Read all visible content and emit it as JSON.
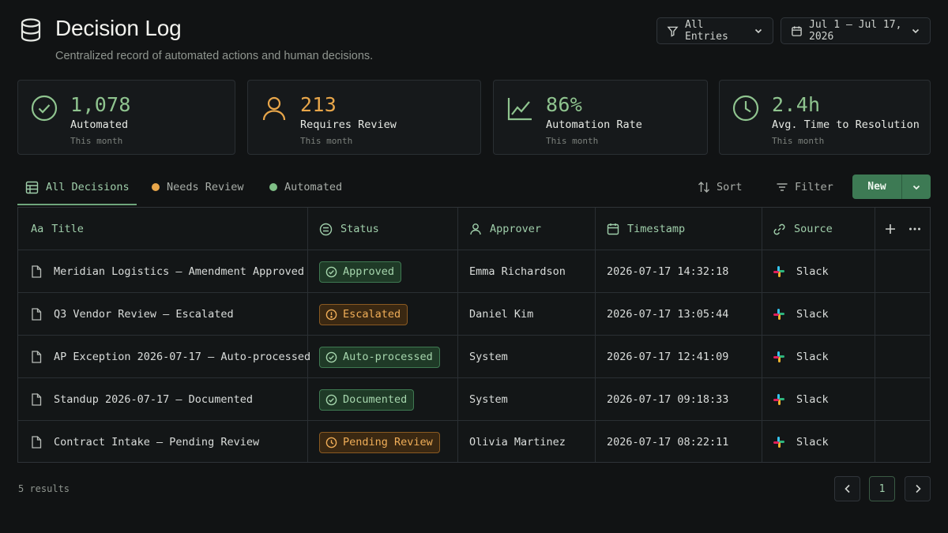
{
  "header": {
    "title": "Decision Log",
    "subtitle": "Centralized record of automated actions and human decisions.",
    "filter_label": "All Entries",
    "date_range": "Jul 1 – Jul 17, 2026"
  },
  "stats": [
    {
      "value": "1,078",
      "label": "Automated",
      "sub": "This month",
      "icon": "check-circle-icon",
      "color": "#8fc48f"
    },
    {
      "value": "213",
      "label": "Requires Review",
      "sub": "This month",
      "icon": "user-icon",
      "color": "#e8a64a"
    },
    {
      "value": "86%",
      "label": "Automation Rate",
      "sub": "This month",
      "icon": "trend-line-icon",
      "color": "#8fc48f"
    },
    {
      "value": "2.4h",
      "label": "Avg. Time to Resolution",
      "sub": "This month",
      "icon": "clock-icon",
      "color": "#8fc48f"
    }
  ],
  "tabs": [
    {
      "label": "All Decisions",
      "active": true
    },
    {
      "label": "Needs Review",
      "dot_color": "#e8a64a"
    },
    {
      "label": "Automated",
      "dot_color": "#7fbf86"
    }
  ],
  "toolbar": {
    "sort_label": "Sort",
    "filter_label": "Filter",
    "new_label": "New"
  },
  "table": {
    "columns": [
      {
        "label": "Title",
        "prefix": "Aa"
      },
      {
        "label": "Status"
      },
      {
        "label": "Approver"
      },
      {
        "label": "Timestamp"
      },
      {
        "label": "Source"
      }
    ],
    "rows": [
      {
        "title": "Meridian Logistics – Amendment Approved",
        "status": "Approved",
        "status_tone": "green",
        "approver": "Emma Richardson",
        "timestamp": "2026-07-17 14:32:18",
        "source": "Slack"
      },
      {
        "title": "Q3 Vendor Review – Escalated",
        "status": "Escalated",
        "status_tone": "orange",
        "approver": "Daniel Kim",
        "timestamp": "2026-07-17 13:05:44",
        "source": "Slack"
      },
      {
        "title": "AP Exception 2026-07-17 – Auto-processed",
        "status": "Auto-processed",
        "status_tone": "green",
        "approver": "System",
        "timestamp": "2026-07-17 12:41:09",
        "source": "Slack"
      },
      {
        "title": "Standup 2026-07-17 – Documented",
        "status": "Documented",
        "status_tone": "green",
        "approver": "System",
        "timestamp": "2026-07-17 09:18:33",
        "source": "Slack"
      },
      {
        "title": "Contract Intake – Pending Review",
        "status": "Pending Review",
        "status_tone": "orange",
        "approver": "Olivia Martinez",
        "timestamp": "2026-07-17 08:22:11",
        "source": "Slack"
      }
    ]
  },
  "footer": {
    "results": "5 results",
    "page": "1"
  }
}
